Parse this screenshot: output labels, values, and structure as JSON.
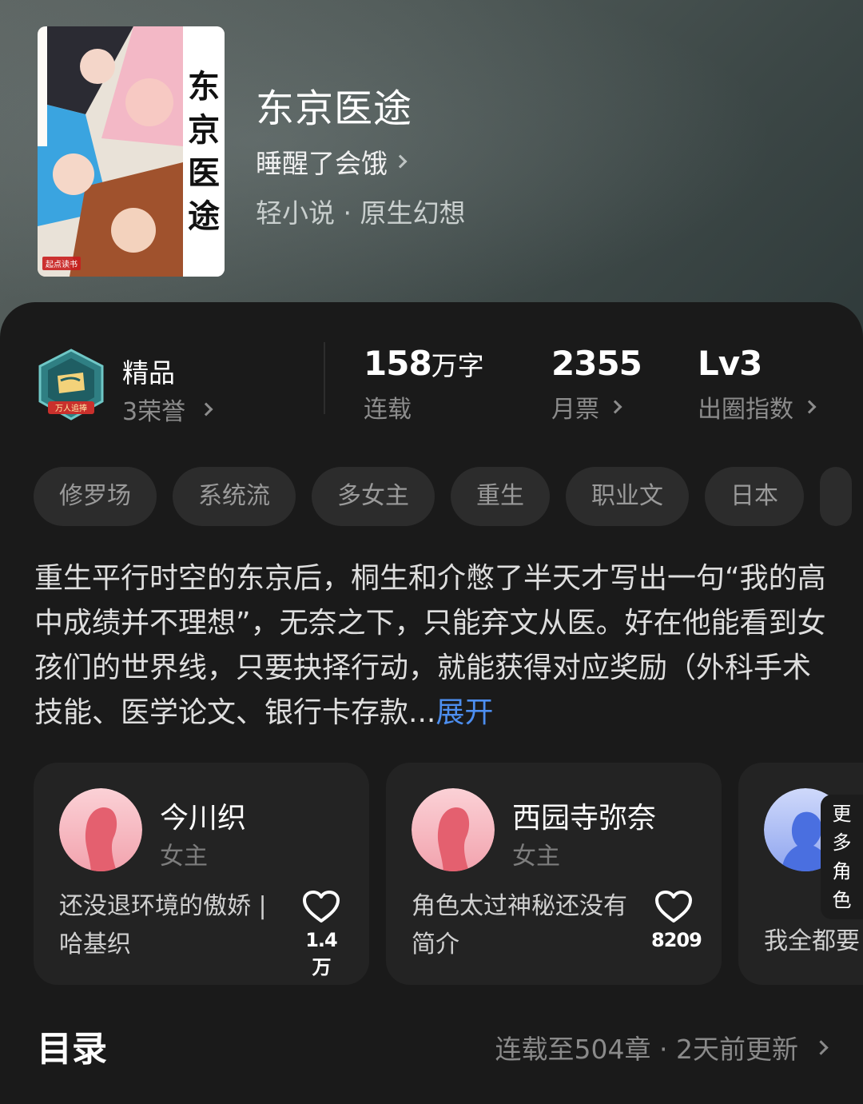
{
  "book": {
    "title": "东京医途",
    "author": "睡醒了会饿",
    "genre": "轻小说 · 原生幻想",
    "cover_title_chars": [
      "东",
      "京",
      "医",
      "途"
    ],
    "cover_publisher": "起点读书"
  },
  "honor": {
    "badge_text": "万人追捧",
    "title": "精品",
    "subtitle": "3荣誉"
  },
  "stats": [
    {
      "value": "158",
      "unit": "万字",
      "label": "连载"
    },
    {
      "value": "2355",
      "unit": "",
      "label": "月票"
    },
    {
      "value": "Lv3",
      "unit": "",
      "label": "出圈指数"
    }
  ],
  "tags": [
    "修罗场",
    "系统流",
    "多女主",
    "重生",
    "职业文",
    "日本"
  ],
  "synopsis": {
    "text": "重生平行时空的东京后，桐生和介憋了半天才写出一句“我的高中成绩并不理想”，无奈之下，只能弃文从医。好在他能看到女孩们的世界线，只要抉择行动，就能获得对应奖励（外科手术技能、医学论文、银行卡存款...",
    "expand_label": "展开"
  },
  "characters": [
    {
      "name": "今川织",
      "role": "女主",
      "desc": "还没退环境的傲娇 | 哈基织",
      "likes": "1.4万"
    },
    {
      "name": "西园寺弥奈",
      "role": "女主",
      "desc": "角色太过神秘还没有简介",
      "likes": "8209"
    },
    {
      "name": "",
      "role": "",
      "desc": "我全都要",
      "likes": ""
    }
  ],
  "more_characters_label": [
    "更",
    "多",
    "角",
    "色"
  ],
  "toc": {
    "title": "目录",
    "meta": "连载至504章 · 2天前更新"
  },
  "colors": {
    "accent_blue": "#4d8ff0",
    "panel_bg": "#1a1a1a",
    "card_bg": "#232323",
    "tag_bg": "#2c2c2c"
  }
}
